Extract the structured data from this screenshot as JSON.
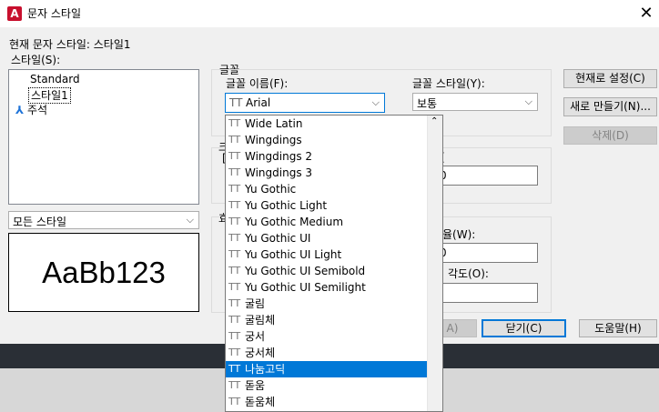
{
  "window": {
    "title": "문자 스타일",
    "icon": "autocad-a-icon",
    "close_label": "✕"
  },
  "current_style": "현재 문자 스타일:  스타일1",
  "styles": {
    "label": "스타일(S):",
    "items": [
      {
        "label": "Standard",
        "icon": ""
      },
      {
        "label": "스타일1",
        "icon": ""
      },
      {
        "label": "주석",
        "icon": "annotative-icon"
      }
    ],
    "filter_value": "모든 스타일"
  },
  "preview": {
    "text": "AaBb123"
  },
  "font": {
    "group_label": "글꼴",
    "name_label": "글꼴 이름(F):",
    "name_value": "Arial",
    "style_label": "글꼴 스타일(Y):",
    "style_value": "보통"
  },
  "font_list": [
    "Wide Latin",
    "Wingdings",
    "Wingdings 2",
    "Wingdings 3",
    "Yu Gothic",
    "Yu Gothic Light",
    "Yu Gothic Medium",
    "Yu Gothic UI",
    "Yu Gothic UI Light",
    "Yu Gothic UI Semibold",
    "Yu Gothic UI Semilight",
    "굴림",
    "굴림체",
    "궁서",
    "궁서체",
    "나눔고딕",
    "돋움",
    "돋움체"
  ],
  "font_list_selected": "나눔고딕",
  "partial": {
    "size_frag": "크",
    "check_frag": "[",
    "effects_frag": "효",
    "paren1": "(",
    "paren2": ")",
    "num1": "0",
    "width_label_frag": "율(W):",
    "num2": "0",
    "angle_label_frag": "각도(O):",
    "apply_frag": "A)"
  },
  "buttons": {
    "set_current": "현재로 설정(C)",
    "new": "새로 만들기(N)...",
    "delete": "삭제(D)",
    "close": "닫기(C)",
    "help": "도움말(H)"
  },
  "colors": {
    "accent": "#0078d7",
    "app_icon": "#c8102e"
  }
}
